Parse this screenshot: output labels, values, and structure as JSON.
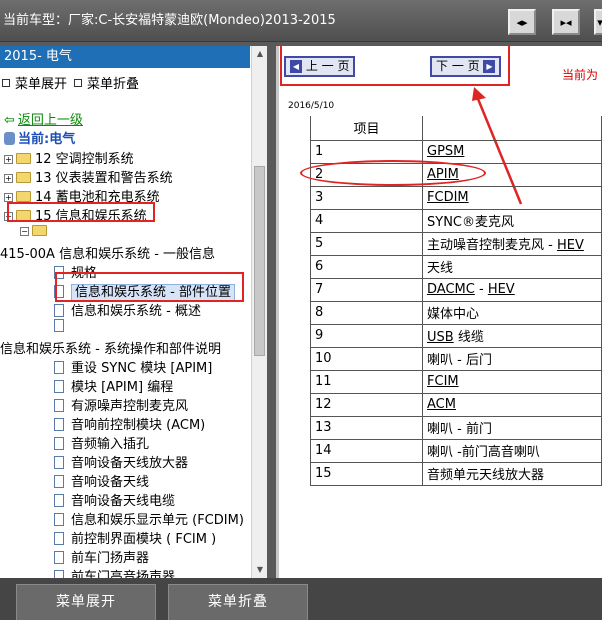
{
  "titlebar": {
    "title": "当前车型：厂家:C-长安福特蒙迪欧(Mondeo)2013-2015",
    "buttons": [
      "◂▸",
      "▸◂",
      "▾"
    ]
  },
  "left": {
    "section_header": "2015- 电气",
    "expand_label": "菜单展开",
    "collapse_label": "菜单折叠",
    "back_label": "返回上一级",
    "current_label": "当前:电气",
    "folders": [
      "12 空调控制系统",
      "13 仪表装置和警告系统",
      "14 蓄电池和充电系统",
      "15 信息和娱乐系统"
    ],
    "group1_title": "415-00A 信息和娱乐系统 - 一般信息",
    "group1_items": [
      "规格",
      "信息和娱乐系统 - 部件位置",
      "信息和娱乐系统 - 概述",
      ""
    ],
    "group2_title": "信息和娱乐系统 - 系统操作和部件说明",
    "group2_items": [
      "重设 SYNC 模块 [APIM]",
      "模块 [APIM] 编程",
      "有源噪声控制麦克风",
      "音响前控制模块 (ACM)",
      "音频输入插孔",
      "音响设备天线放大器",
      "音响设备天线",
      "音响设备天线电缆",
      "信息和娱乐显示单元 (FCDIM)",
      "前控制界面模块 ( FCIM )",
      "前车门扬声器",
      "前车门高音扬声器"
    ]
  },
  "right": {
    "prev_label": "上 一 页",
    "next_label": "下 一 页",
    "page_info": "当前为",
    "date": "2016/5/10",
    "col_header": "项目",
    "rows": [
      {
        "n": "1",
        "name": "GPSM"
      },
      {
        "n": "2",
        "name": "APIM"
      },
      {
        "n": "3",
        "name": "FCDIM"
      },
      {
        "n": "4",
        "name": "SYNC®麦克风"
      },
      {
        "n": "5",
        "name": "主动噪音控制麦克风 - HEV"
      },
      {
        "n": "6",
        "name": "天线"
      },
      {
        "n": "7",
        "name": "DACMC - HEV"
      },
      {
        "n": "8",
        "name": "媒体中心"
      },
      {
        "n": "9",
        "name": "USB 线缆"
      },
      {
        "n": "10",
        "name": "喇叭 - 后门"
      },
      {
        "n": "11",
        "name": "FCIM"
      },
      {
        "n": "12",
        "name": "ACM"
      },
      {
        "n": "13",
        "name": "喇叭 - 前门"
      },
      {
        "n": "14",
        "name": "喇叭 -前门高音喇叭"
      },
      {
        "n": "15",
        "name": "音频单元天线放大器"
      }
    ]
  },
  "bottom": {
    "expand_button": "菜单展开",
    "collapse_button": "菜单折叠"
  }
}
